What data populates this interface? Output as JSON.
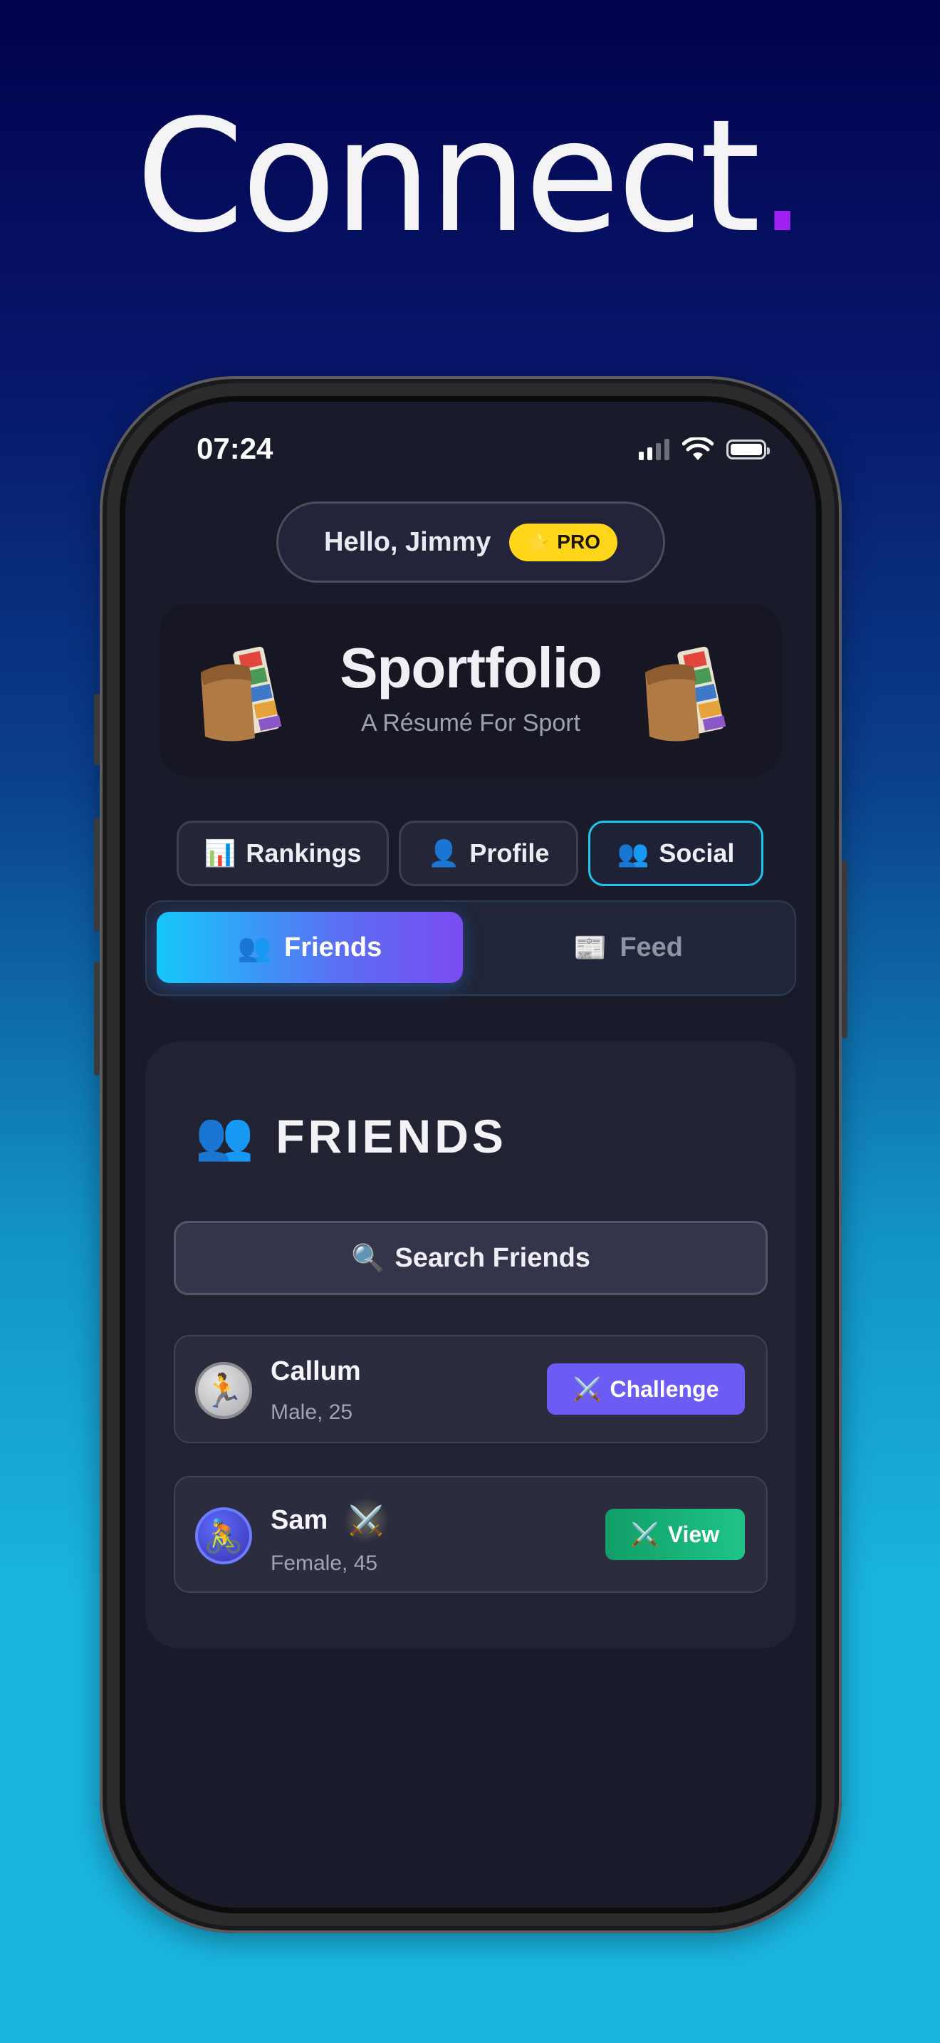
{
  "headline": {
    "text": "Connect",
    "dot": "."
  },
  "status_bar": {
    "time": "07:24"
  },
  "greeting": {
    "text": "Hello, Jimmy",
    "badge_icon": "⭐",
    "badge_label": "PRO"
  },
  "hero": {
    "title": "Sportfolio",
    "subtitle": "A Résumé For Sport"
  },
  "nav": [
    {
      "icon": "📊",
      "label": "Rankings"
    },
    {
      "icon": "👤",
      "label": "Profile"
    },
    {
      "icon": "👥",
      "label": "Social",
      "selected": true
    }
  ],
  "segmented": [
    {
      "icon": "👥",
      "label": "Friends",
      "active": true
    },
    {
      "icon": "📰",
      "label": "Feed",
      "active": false
    }
  ],
  "friends_section": {
    "title_icon": "👥",
    "title": "FRIENDS",
    "search_icon": "🔍",
    "search_label": "Search Friends",
    "friends": [
      {
        "avatar": "🏃",
        "name": "Callum",
        "meta": "Male, 25",
        "action_icon": "⚔️",
        "action": "Challenge"
      },
      {
        "avatar": "🚴",
        "name": "Sam",
        "name_icon": "⚔️",
        "meta": "Female, 45",
        "action_icon": "⚔️",
        "action": "View"
      }
    ]
  },
  "colors": {
    "accent_cyan": "#1ec6ee",
    "accent_purple": "#a020f0",
    "pro_yellow": "#ffd619",
    "challenge": "#6c5cf6",
    "view": "#1fc489"
  }
}
